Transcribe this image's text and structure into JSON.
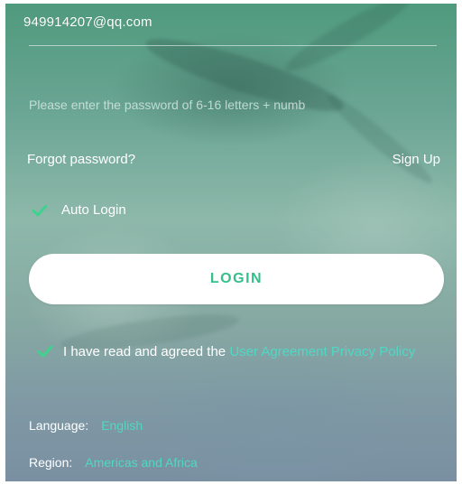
{
  "login_form": {
    "email_value": "949914207@qq.com",
    "password_hint": "Please enter the password of 6-16 letters + numb",
    "forgot_password": "Forgot password?",
    "sign_up": "Sign Up",
    "auto_login_label": "Auto Login",
    "auto_login_checked": true,
    "login_button": "LOGIN"
  },
  "agreement": {
    "checked": true,
    "prefix": "I have read and agreed the ",
    "user_agreement": "User Agreement",
    "privacy_policy": "Privacy Policy"
  },
  "settings": {
    "language_label": "Language:",
    "language_value": "English",
    "region_label": "Region:",
    "region_value": "Americas and Africa"
  },
  "colors": {
    "accent": "#35c08a",
    "link": "#4fd8c4",
    "background_top": "#4f9a7e",
    "background_bottom": "#7a90a2"
  },
  "icons": {
    "checkbox": "checkmark-icon"
  }
}
